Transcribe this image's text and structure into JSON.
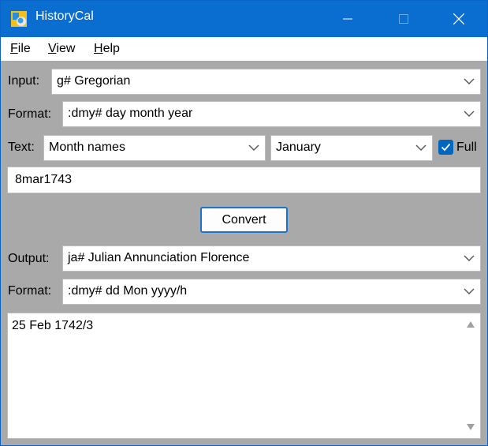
{
  "window": {
    "title": "HistoryCal"
  },
  "menu": {
    "file": {
      "key": "F",
      "rest": "ile"
    },
    "view": {
      "key": "V",
      "rest": "iew"
    },
    "help": {
      "key": "H",
      "rest": "elp"
    }
  },
  "input": {
    "label": "Input:",
    "calendar": "g#  Gregorian",
    "format_label": "Format:",
    "format": ":dmy#  day month year",
    "text_label": "Text:",
    "text_mode": "Month names",
    "text_month": "January",
    "full_label": "Full",
    "full_checked": true,
    "date_value": "8mar1743"
  },
  "convert_label": "Convert",
  "output": {
    "label": "Output:",
    "calendar": "ja#  Julian Annunciation Florence",
    "format_label": "Format:",
    "format": ":dmy#  dd Mon yyyy/h",
    "result": "25 Feb 1742/3"
  },
  "colors": {
    "titlebar": "#0a6ed1",
    "body": "#a9a9a9",
    "accent": "#0067c0"
  }
}
